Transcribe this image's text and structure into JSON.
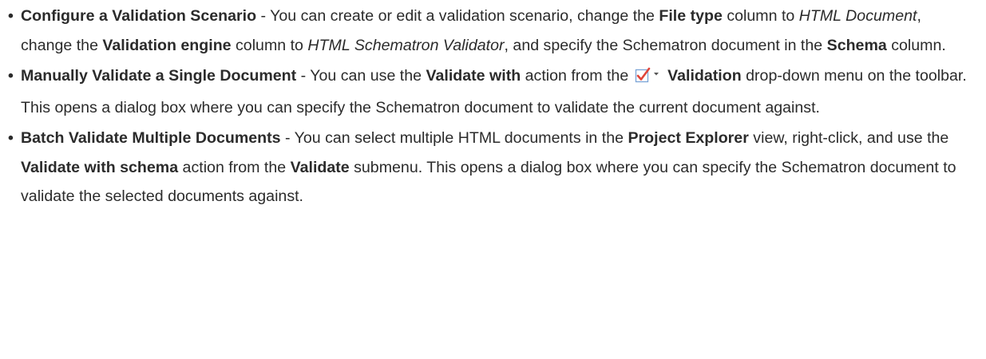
{
  "items": [
    {
      "title": "Configure a Validation Scenario",
      "segments": [
        {
          "t": " - You can create or edit a validation scenario, change the "
        },
        {
          "t": "File type",
          "b": true
        },
        {
          "t": " column to "
        },
        {
          "t": "HTML Document",
          "i": true
        },
        {
          "t": ", change the "
        },
        {
          "t": "Validation engine",
          "b": true
        },
        {
          "t": " column to "
        },
        {
          "t": "HTML Schematron Validator",
          "i": true
        },
        {
          "t": ", and specify the Schematron document in the "
        },
        {
          "t": "Schema",
          "b": true
        },
        {
          "t": " column."
        }
      ]
    },
    {
      "title": "Manually Validate a Single Document",
      "segments": [
        {
          "t": " - You can use the "
        },
        {
          "t": "Validate with",
          "b": true
        },
        {
          "t": " action from the "
        },
        {
          "icon": "validation-checkbox-icon"
        },
        {
          "t": " "
        },
        {
          "t": "Validation",
          "b": true
        },
        {
          "t": " drop-down menu on the toolbar. This opens a dialog box where you can specify the Schematron document to validate the current document against."
        }
      ]
    },
    {
      "title": "Batch Validate Multiple Documents",
      "segments": [
        {
          "t": " - You can select multiple HTML documents in the "
        },
        {
          "t": "Project Explorer",
          "b": true
        },
        {
          "t": " view, right-click, and use the "
        },
        {
          "t": "Validate with schema",
          "b": true
        },
        {
          "t": " action from the "
        },
        {
          "t": "Validate",
          "b": true
        },
        {
          "t": " submenu. This opens a dialog box where you can specify the Schematron document to validate the selected documents against."
        }
      ]
    }
  ],
  "colors": {
    "text": "#2b2b2b",
    "icon_check": "#e0453a",
    "icon_box": "#7aa3d6"
  }
}
